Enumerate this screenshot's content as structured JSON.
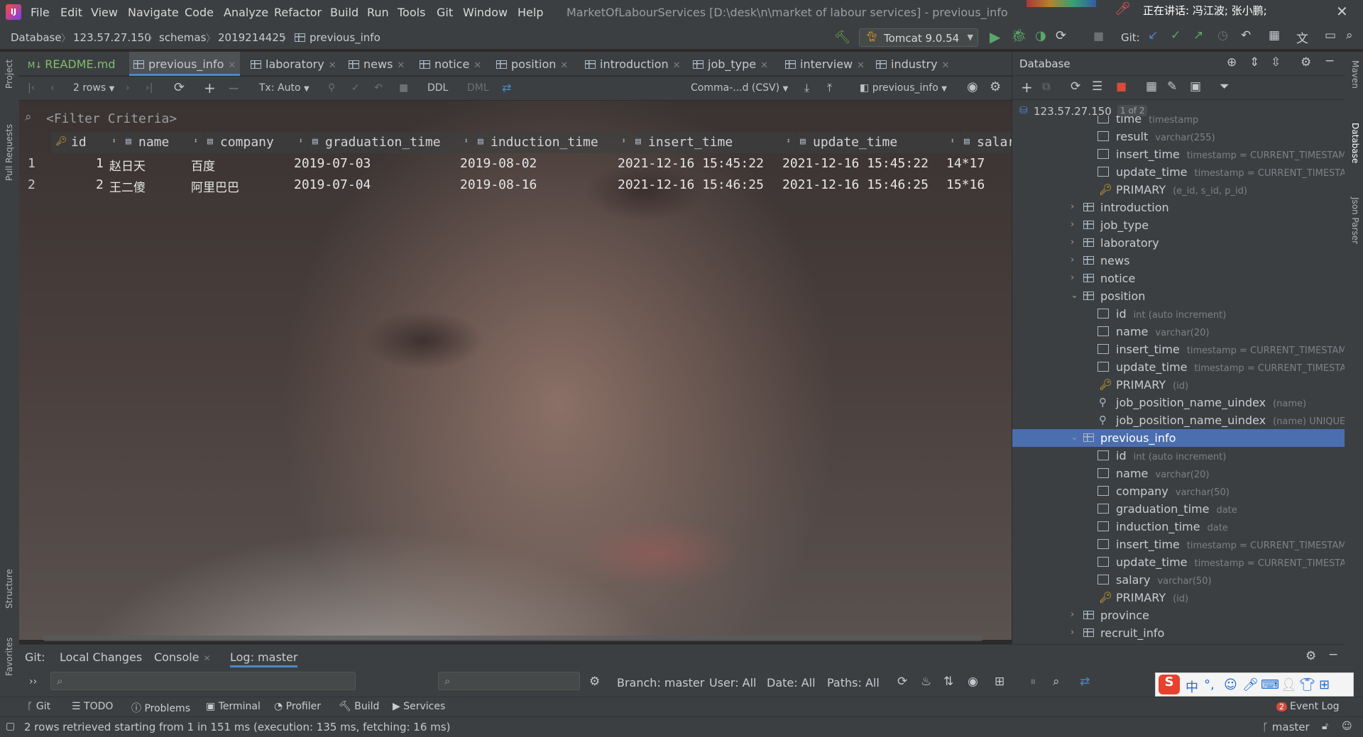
{
  "app": {
    "logo": "IJ",
    "menu": [
      "File",
      "Edit",
      "View",
      "Navigate",
      "Code",
      "Analyze",
      "Refactor",
      "Build",
      "Run",
      "Tools",
      "Git",
      "Window",
      "Help"
    ],
    "window_title": "MarketOfLabourServices [D:\\desk\\n\\market of labour services] - previous_info",
    "speaking": "正在讲话: 冯江波; 张小鹏;"
  },
  "breadcrumb": [
    "Database",
    "123.57.27.150",
    "schemas",
    "2019214425",
    "previous_info"
  ],
  "run": {
    "config": "Tomcat 9.0.54",
    "git_label": "Git:"
  },
  "tabs": [
    {
      "label": "README.md",
      "color": "#7fbf6a"
    },
    {
      "label": "previous_info",
      "active": true
    },
    {
      "label": "laboratory"
    },
    {
      "label": "news"
    },
    {
      "label": "notice"
    },
    {
      "label": "position"
    },
    {
      "label": "introduction"
    },
    {
      "label": "job_type"
    },
    {
      "label": "interview"
    },
    {
      "label": "industry"
    }
  ],
  "grid_toolbar": {
    "rows": "2 rows",
    "tx": "Tx: Auto",
    "ddl": "DDL",
    "dml": "DML",
    "export_format": "Comma-...d (CSV)",
    "table_view": "previous_info"
  },
  "filter_placeholder": "<Filter Criteria>",
  "grid": {
    "columns": [
      "id",
      "name",
      "company",
      "graduation_time",
      "induction_time",
      "insert_time",
      "update_time",
      "salary"
    ],
    "rows": [
      [
        "1",
        "1",
        "赵日天",
        "百度",
        "2019-07-03",
        "2019-08-02",
        "2021-12-16 15:45:22",
        "2021-12-16 15:45:22",
        "14*17"
      ],
      [
        "2",
        "2",
        "王二傻",
        "阿里巴巴",
        "2019-07-04",
        "2019-08-16",
        "2021-12-16 15:46:25",
        "2021-12-16 15:46:25",
        "15*16"
      ]
    ]
  },
  "database_panel": {
    "title": "Database",
    "host": "123.57.27.150",
    "host_badge": "1 of 2",
    "tree": [
      {
        "label": "time",
        "type": "timestamp",
        "kind": "col"
      },
      {
        "label": "result",
        "type": "varchar(255)",
        "kind": "col"
      },
      {
        "label": "insert_time",
        "type": "timestamp = CURRENT_TIMESTAMP",
        "kind": "col"
      },
      {
        "label": "update_time",
        "type": "timestamp = CURRENT_TIMESTAM",
        "kind": "col"
      },
      {
        "label": "PRIMARY",
        "type": "(e_id, s_id, p_id)",
        "kind": "key"
      },
      {
        "label": "introduction",
        "type": "",
        "kind": "table"
      },
      {
        "label": "job_type",
        "type": "",
        "kind": "table"
      },
      {
        "label": "laboratory",
        "type": "",
        "kind": "table"
      },
      {
        "label": "news",
        "type": "",
        "kind": "table"
      },
      {
        "label": "notice",
        "type": "",
        "kind": "table"
      },
      {
        "label": "position",
        "type": "",
        "kind": "table-open"
      },
      {
        "label": "id",
        "type": "int (auto increment)",
        "kind": "col"
      },
      {
        "label": "name",
        "type": "varchar(20)",
        "kind": "col"
      },
      {
        "label": "insert_time",
        "type": "timestamp = CURRENT_TIMESTAMP",
        "kind": "col"
      },
      {
        "label": "update_time",
        "type": "timestamp = CURRENT_TIMESTAM",
        "kind": "col"
      },
      {
        "label": "PRIMARY",
        "type": "(id)",
        "kind": "key"
      },
      {
        "label": "job_position_name_uindex",
        "type": "(name)",
        "kind": "idx"
      },
      {
        "label": "job_position_name_uindex",
        "type": "(name) UNIQUE",
        "kind": "idx"
      },
      {
        "label": "previous_info",
        "type": "",
        "kind": "table-open-sel"
      },
      {
        "label": "id",
        "type": "int (auto increment)",
        "kind": "col"
      },
      {
        "label": "name",
        "type": "varchar(20)",
        "kind": "col"
      },
      {
        "label": "company",
        "type": "varchar(50)",
        "kind": "col"
      },
      {
        "label": "graduation_time",
        "type": "date",
        "kind": "col"
      },
      {
        "label": "induction_time",
        "type": "date",
        "kind": "col"
      },
      {
        "label": "insert_time",
        "type": "timestamp = CURRENT_TIMESTAMP",
        "kind": "col"
      },
      {
        "label": "update_time",
        "type": "timestamp = CURRENT_TIMESTAM",
        "kind": "col"
      },
      {
        "label": "salary",
        "type": "varchar(50)",
        "kind": "col"
      },
      {
        "label": "PRIMARY",
        "type": "(id)",
        "kind": "key"
      },
      {
        "label": "province",
        "type": "",
        "kind": "table"
      },
      {
        "label": "recruit_info",
        "type": "",
        "kind": "table"
      }
    ]
  },
  "side_labels": {
    "left": [
      "Project",
      "Pull Requests",
      "Structure",
      "Favorites"
    ],
    "right": [
      "Maven",
      "Database",
      "Json Parser"
    ]
  },
  "git_panel": {
    "label": "Git:",
    "tabs": [
      "Local Changes",
      "Console",
      "Log: master"
    ],
    "branch": "Branch: master",
    "user": "User: All",
    "date": "Date: All",
    "paths": "Paths: All"
  },
  "tool_windows": [
    "Git",
    "TODO",
    "Problems",
    "Terminal",
    "Profiler",
    "Build",
    "Services"
  ],
  "event_log": {
    "count": "2",
    "label": "Event Log"
  },
  "status": {
    "message": "2 rows retrieved starting from 1 in 151 ms (execution: 135 ms, fetching: 16 ms)",
    "branch": "master"
  },
  "ime": {
    "brand": "S",
    "items": [
      "中",
      "°,"
    ]
  }
}
